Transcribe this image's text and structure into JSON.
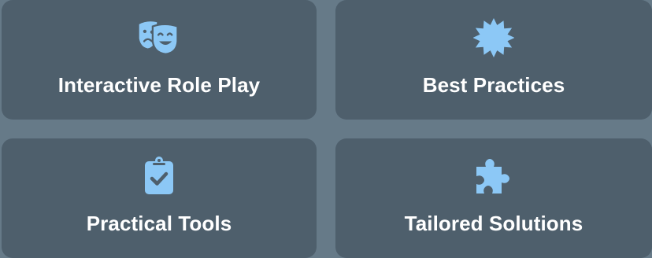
{
  "cards": [
    {
      "label": "Interactive Role Play",
      "icon": "theater-masks-icon"
    },
    {
      "label": "Best Practices",
      "icon": "certificate-badge-icon"
    },
    {
      "label": "Practical Tools",
      "icon": "clipboard-check-icon"
    },
    {
      "label": "Tailored Solutions",
      "icon": "puzzle-piece-icon"
    }
  ],
  "colors": {
    "background": "#667a88",
    "card": "#4e5f6c",
    "icon": "#8cc8f6",
    "text": "#ffffff"
  }
}
